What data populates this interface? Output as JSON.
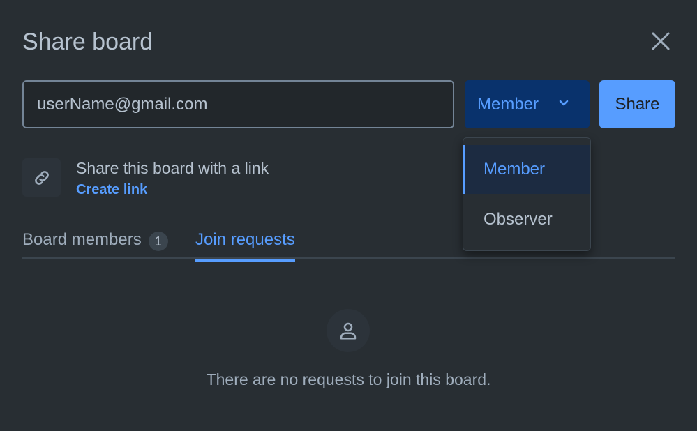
{
  "modal": {
    "title": "Share board"
  },
  "invite": {
    "email_value": "userName@gmail.com",
    "role_selected": "Member",
    "share_label": "Share"
  },
  "link_section": {
    "label": "Share this board with a link",
    "create_link": "Create link"
  },
  "tabs": {
    "members_label": "Board members",
    "members_count": "1",
    "requests_label": "Join requests",
    "active": "Join requests"
  },
  "empty_state": {
    "message": "There are no requests to join this board."
  },
  "role_dropdown": {
    "options": [
      "Member",
      "Observer"
    ],
    "selected": "Member"
  },
  "icons": {
    "close": "close-icon",
    "chevron": "chevron-down-icon",
    "link": "link-icon",
    "person": "person-icon"
  },
  "colors": {
    "background": "#282e33",
    "accent": "#579dff",
    "select_bg": "#09326c"
  }
}
